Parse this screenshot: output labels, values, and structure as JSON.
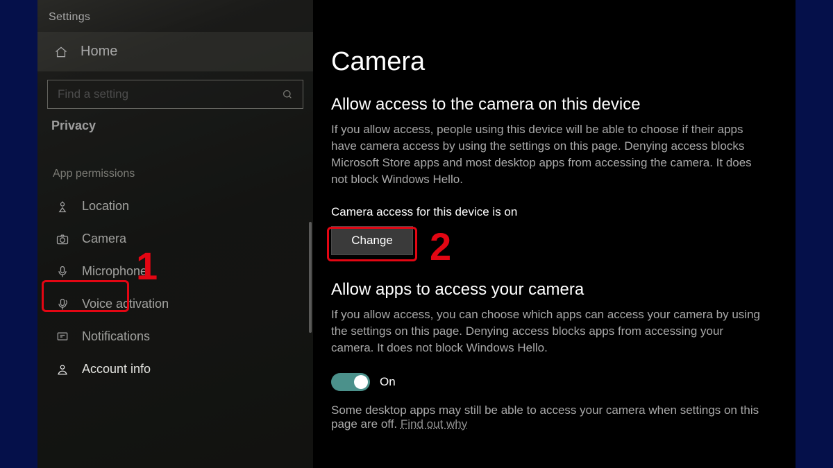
{
  "app_title": "Settings",
  "home": {
    "label": "Home"
  },
  "search": {
    "placeholder": "Find a setting"
  },
  "category": "Privacy",
  "section_header": "App permissions",
  "nav_items": [
    {
      "key": "location",
      "label": "Location"
    },
    {
      "key": "camera",
      "label": "Camera"
    },
    {
      "key": "microphone",
      "label": "Microphone"
    },
    {
      "key": "voice-activation",
      "label": "Voice activation"
    },
    {
      "key": "notifications",
      "label": "Notifications"
    },
    {
      "key": "account-info",
      "label": "Account info"
    }
  ],
  "page": {
    "title": "Camera",
    "h1": "Allow access to the camera on this device",
    "p1": "If you allow access, people using this device will be able to choose if their apps have camera access by using the settings on this page. Denying access blocks Microsoft Store apps and most desktop apps from accessing the camera. It does not block Windows Hello.",
    "status": "Camera access for this device is on",
    "change": "Change",
    "h2": "Allow apps to access your camera",
    "p2": "If you allow access, you can choose which apps can access your camera by using the settings on this page. Denying access blocks apps from accessing your camera. It does not block Windows Hello.",
    "toggle_state": "On",
    "p3a": "Some desktop apps may still be able to access your camera when settings on this page are off. ",
    "p3_link": "Find out why"
  },
  "annotations": {
    "one": "1",
    "two": "2"
  }
}
